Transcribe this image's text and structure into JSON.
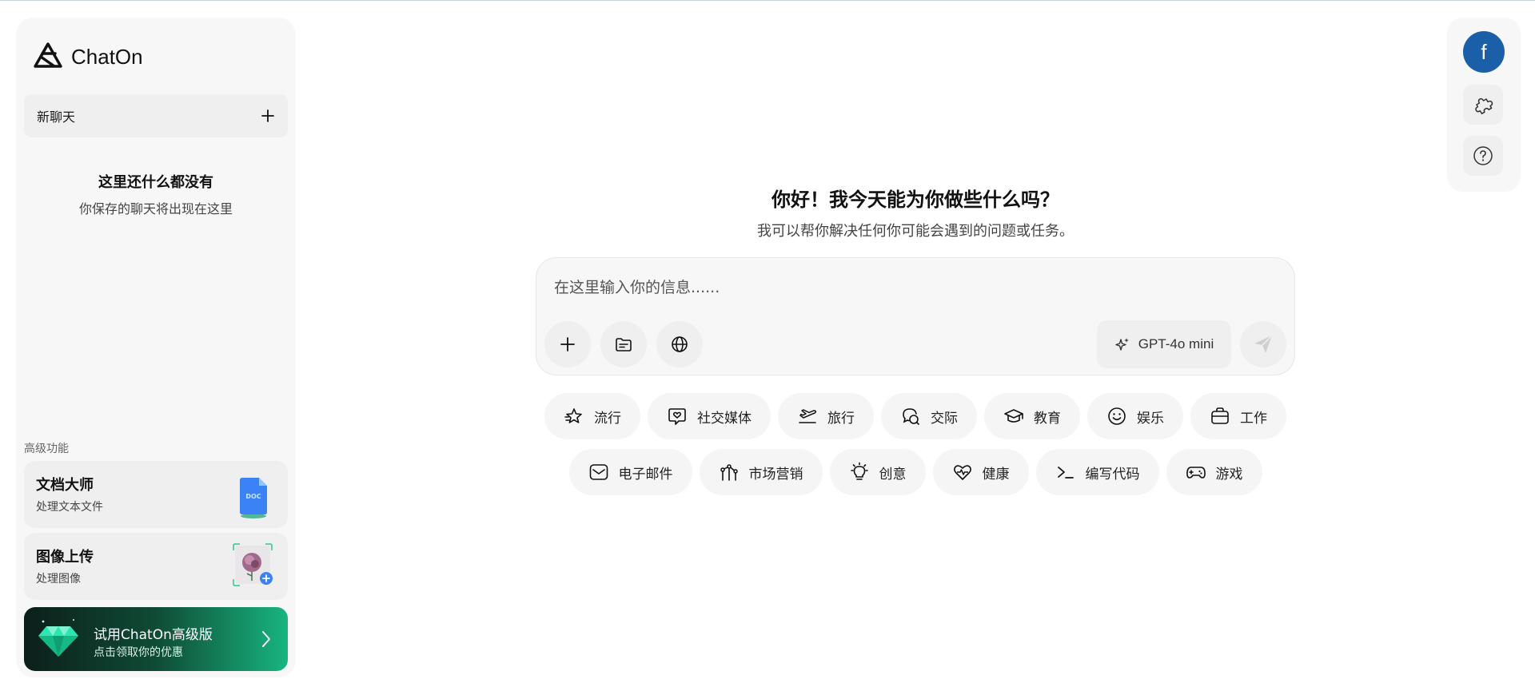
{
  "app": {
    "name": "ChatOn"
  },
  "sidebar": {
    "new_chat_label": "新聊天",
    "empty_title": "这里还什么都没有",
    "empty_subtitle": "你保存的聊天将出现在这里",
    "section_label": "高级功能",
    "features": [
      {
        "title": "文档大师",
        "subtitle": "处理文本文件",
        "icon": "doc-file-icon",
        "icon_text": "DOC"
      },
      {
        "title": "图像上传",
        "subtitle": "处理图像",
        "icon": "image-upload-icon"
      }
    ],
    "promo": {
      "title": "试用ChatOn高级版",
      "subtitle": "点击领取你的优惠"
    }
  },
  "main": {
    "greeting": "你好！我今天能为你做些什么吗？",
    "subtitle": "我可以帮你解决任何你可能会遇到的问题或任务。",
    "composer": {
      "placeholder": "在这里输入你的信息......",
      "value": "",
      "model_label": "GPT-4o mini"
    },
    "chips_row1": [
      {
        "label": "流行",
        "icon": "star-trending-icon"
      },
      {
        "label": "社交媒体",
        "icon": "social-heart-icon"
      },
      {
        "label": "旅行",
        "icon": "airplane-icon"
      },
      {
        "label": "交际",
        "icon": "chat-bubbles-icon"
      },
      {
        "label": "教育",
        "icon": "graduation-cap-icon"
      },
      {
        "label": "娱乐",
        "icon": "smiley-icon"
      },
      {
        "label": "工作",
        "icon": "briefcase-icon"
      }
    ],
    "chips_row2": [
      {
        "label": "电子邮件",
        "icon": "mail-icon"
      },
      {
        "label": "市场营销",
        "icon": "marketing-icon"
      },
      {
        "label": "创意",
        "icon": "lightbulb-icon"
      },
      {
        "label": "健康",
        "icon": "heart-pulse-icon"
      },
      {
        "label": "编写代码",
        "icon": "terminal-icon"
      },
      {
        "label": "游戏",
        "icon": "gamepad-icon"
      }
    ]
  },
  "rail": {
    "avatar_letter": "f"
  },
  "colors": {
    "promo_start": "#0c1f1a",
    "promo_end": "#17b57f",
    "avatar_bg": "#1b5fa8",
    "doc_blue": "#3b82f6"
  }
}
